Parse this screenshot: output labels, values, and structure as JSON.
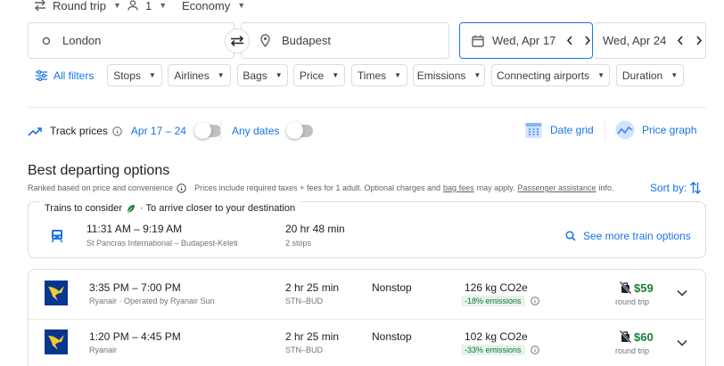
{
  "top": {
    "trip_type": "Round trip",
    "passengers": "1",
    "cabin": "Economy"
  },
  "search": {
    "origin": "London",
    "destination": "Budapest",
    "depart_date": "Wed, Apr 17",
    "return_date": "Wed, Apr 24"
  },
  "filters": {
    "all_filters": "All filters",
    "chips": [
      "Stops",
      "Airlines",
      "Bags",
      "Price",
      "Times",
      "Emissions",
      "Connecting airports",
      "Duration"
    ]
  },
  "tracking": {
    "track_prices": "Track prices",
    "date_range": "Apr 17 – 24",
    "any_dates": "Any dates",
    "date_grid": "Date grid",
    "price_graph": "Price graph"
  },
  "results": {
    "heading": "Best departing options",
    "ranked_text": "Ranked based on price and convenience",
    "info_prefix": "Prices include required taxes + fees for 1 adult. Optional charges and",
    "bag_fees": "bag fees",
    "info_mid": "may apply.",
    "passenger_assistance": "Passenger assistance",
    "info_suffix": "info.",
    "sort_by": "Sort by:"
  },
  "trains": {
    "header_label": "Trains to consider",
    "header_suffix": "· To arrive closer to your destination",
    "times": "11:31 AM – 9:19 AM",
    "stations": "St Pancras International – Budapest-Keleti",
    "duration": "20 hr 48 min",
    "stops": "2 stops",
    "see_more": "See more train options"
  },
  "flights": [
    {
      "times": "3:35 PM – 7:00 PM",
      "airline": "Ryanair · Operated by Ryanair Sun",
      "duration": "2 hr 25 min",
      "route": "STN–BUD",
      "stops": "Nonstop",
      "co2": "126 kg CO2e",
      "emissions": "-18% emissions",
      "price": "$59",
      "price_note": "round trip"
    },
    {
      "times": "1:20 PM – 4:45 PM",
      "airline": "Ryanair",
      "duration": "2 hr 25 min",
      "route": "STN–BUD",
      "stops": "Nonstop",
      "co2": "102 kg CO2e",
      "emissions": "-33% emissions",
      "price": "$60",
      "price_note": "round trip"
    }
  ],
  "colors": {
    "accent": "#1a73e8",
    "green": "#188038",
    "ryanair_blue": "#073590",
    "ryanair_yellow": "#f1c933"
  },
  "icons": [
    "swap-arrows-icon",
    "person-icon",
    "circle-icon",
    "location-pin-icon",
    "calendar-icon",
    "chevron-left-icon",
    "chevron-right-icon",
    "filter-sliders-icon",
    "trend-line-icon",
    "info-icon",
    "date-grid-icon",
    "price-graph-icon",
    "leaf-icon",
    "train-icon",
    "search-icon",
    "sort-arrows-icon",
    "no-bag-icon",
    "chevron-down-icon"
  ]
}
